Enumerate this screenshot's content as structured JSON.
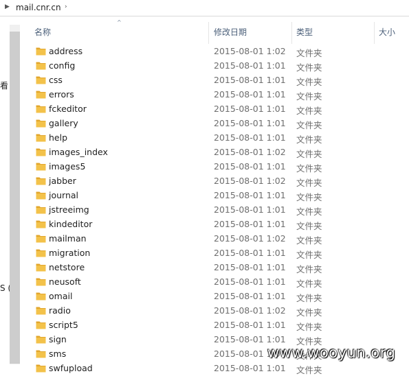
{
  "address_bar": {
    "crumb": "mail.cnr.cn",
    "separator_glyph": "›",
    "expand_glyph": "▶"
  },
  "nav": {
    "fragments": [
      {
        "text": "看"
      },
      {
        "text": "S ("
      }
    ]
  },
  "columns": {
    "name": "名称",
    "date_modified": "修改日期",
    "type": "类型",
    "size": "大小"
  },
  "sort_glyph": "^",
  "files": [
    {
      "name": "address",
      "date": "2015-08-01 1:02",
      "type": "文件夹"
    },
    {
      "name": "config",
      "date": "2015-08-01 1:01",
      "type": "文件夹"
    },
    {
      "name": "css",
      "date": "2015-08-01 1:01",
      "type": "文件夹"
    },
    {
      "name": "errors",
      "date": "2015-08-01 1:01",
      "type": "文件夹"
    },
    {
      "name": "fckeditor",
      "date": "2015-08-01 1:01",
      "type": "文件夹"
    },
    {
      "name": "gallery",
      "date": "2015-08-01 1:01",
      "type": "文件夹"
    },
    {
      "name": "help",
      "date": "2015-08-01 1:01",
      "type": "文件夹"
    },
    {
      "name": "images_index",
      "date": "2015-08-01 1:02",
      "type": "文件夹"
    },
    {
      "name": "images5",
      "date": "2015-08-01 1:01",
      "type": "文件夹"
    },
    {
      "name": "jabber",
      "date": "2015-08-01 1:02",
      "type": "文件夹"
    },
    {
      "name": "journal",
      "date": "2015-08-01 1:01",
      "type": "文件夹"
    },
    {
      "name": "jstreeimg",
      "date": "2015-08-01 1:01",
      "type": "文件夹"
    },
    {
      "name": "kindeditor",
      "date": "2015-08-01 1:01",
      "type": "文件夹"
    },
    {
      "name": "mailman",
      "date": "2015-08-01 1:02",
      "type": "文件夹"
    },
    {
      "name": "migration",
      "date": "2015-08-01 1:01",
      "type": "文件夹"
    },
    {
      "name": "netstore",
      "date": "2015-08-01 1:01",
      "type": "文件夹"
    },
    {
      "name": "neusoft",
      "date": "2015-08-01 1:01",
      "type": "文件夹"
    },
    {
      "name": "omail",
      "date": "2015-08-01 1:01",
      "type": "文件夹"
    },
    {
      "name": "radio",
      "date": "2015-08-01 1:02",
      "type": "文件夹"
    },
    {
      "name": "script5",
      "date": "2015-08-01 1:01",
      "type": "文件夹"
    },
    {
      "name": "sign",
      "date": "2015-08-01 1:01",
      "type": "文件夹"
    },
    {
      "name": "sms",
      "date": "2015-08-01 1:01",
      "type": "文件夹"
    },
    {
      "name": "swfupload",
      "date": "2015-08-01 1:01",
      "type": "文件夹"
    }
  ],
  "watermark": "www.wooyun.org",
  "colors": {
    "folder_body": "#f3c24a",
    "folder_tab": "#e2a62c",
    "header_text": "#4c607a",
    "meta_text": "#6d6d6d"
  },
  "icons": {
    "folder": "folder-icon"
  }
}
